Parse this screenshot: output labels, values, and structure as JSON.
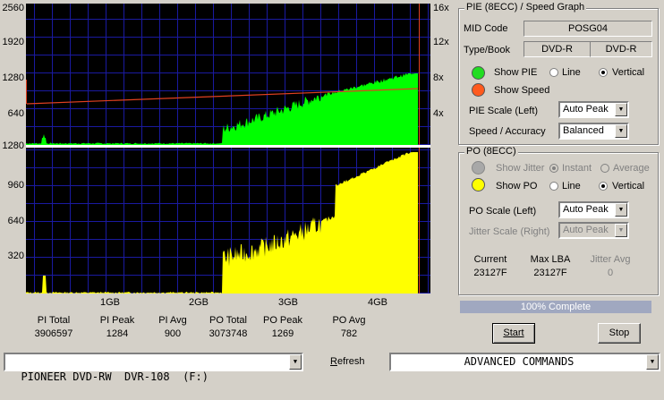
{
  "pie_graph": {
    "y_left_labels": [
      "2560",
      "1920",
      "1280",
      "640"
    ],
    "y_right_labels": [
      "16x",
      "12x",
      "8x",
      "4x"
    ]
  },
  "po_graph": {
    "y_left_labels": [
      "1280",
      "960",
      "640",
      "320"
    ]
  },
  "x_labels": [
    "1GB",
    "2GB",
    "3GB",
    "4GB"
  ],
  "stats": [
    {
      "label": "PI Total",
      "value": "3906597"
    },
    {
      "label": "PI Peak",
      "value": "1284"
    },
    {
      "label": "PI Avg",
      "value": "900"
    },
    {
      "label": "PO Total",
      "value": "3073748"
    },
    {
      "label": "PO Peak",
      "value": "1269"
    },
    {
      "label": "PO Avg",
      "value": "782"
    }
  ],
  "pie_panel": {
    "title": "PIE (8ECC) / Speed Graph",
    "mid_code_label": "MID Code",
    "mid_code_value": "POSG04",
    "type_book_label": "Type/Book",
    "type_value": "DVD-R",
    "book_value": "DVD-R",
    "show_pie_label": "Show PIE",
    "show_speed_label": "Show Speed",
    "line_label": "Line",
    "vertical_label": "Vertical",
    "pie_scale_label": "PIE Scale (Left)",
    "pie_scale_value": "Auto Peak",
    "speed_accuracy_label": "Speed / Accuracy",
    "speed_accuracy_value": "Balanced"
  },
  "po_panel": {
    "title": "PO (8ECC)",
    "show_jitter_label": "Show Jitter",
    "instant_label": "Instant",
    "average_label": "Average",
    "show_po_label": "Show PO",
    "line_label": "Line",
    "vertical_label": "Vertical",
    "po_scale_label": "PO Scale (Left)",
    "po_scale_value": "Auto Peak",
    "jitter_scale_label": "Jitter Scale (Right)",
    "jitter_scale_value": "Auto Peak",
    "current_label": "Current",
    "current_value": "23127F",
    "max_lba_label": "Max LBA",
    "max_lba_value": "23127F",
    "jitter_avg_label": "Jitter Avg",
    "jitter_avg_value": "0"
  },
  "progress": {
    "text": "100% Complete",
    "fraction": 1.0
  },
  "buttons": {
    "start": "Start",
    "stop": "Stop"
  },
  "bottom": {
    "drive_value": "PIONEER DVD-RW  DVR-108  (F:)",
    "refresh_prefix": "R",
    "refresh_rest": "efresh",
    "command_value": "ADVANCED COMMANDS"
  },
  "colors": {
    "pie": "#00ff00",
    "po": "#ffff00",
    "speed": "#e04020",
    "grid": "#1a1aa0",
    "graph_bg": "#000000",
    "progress": "#a0a8c0"
  }
}
